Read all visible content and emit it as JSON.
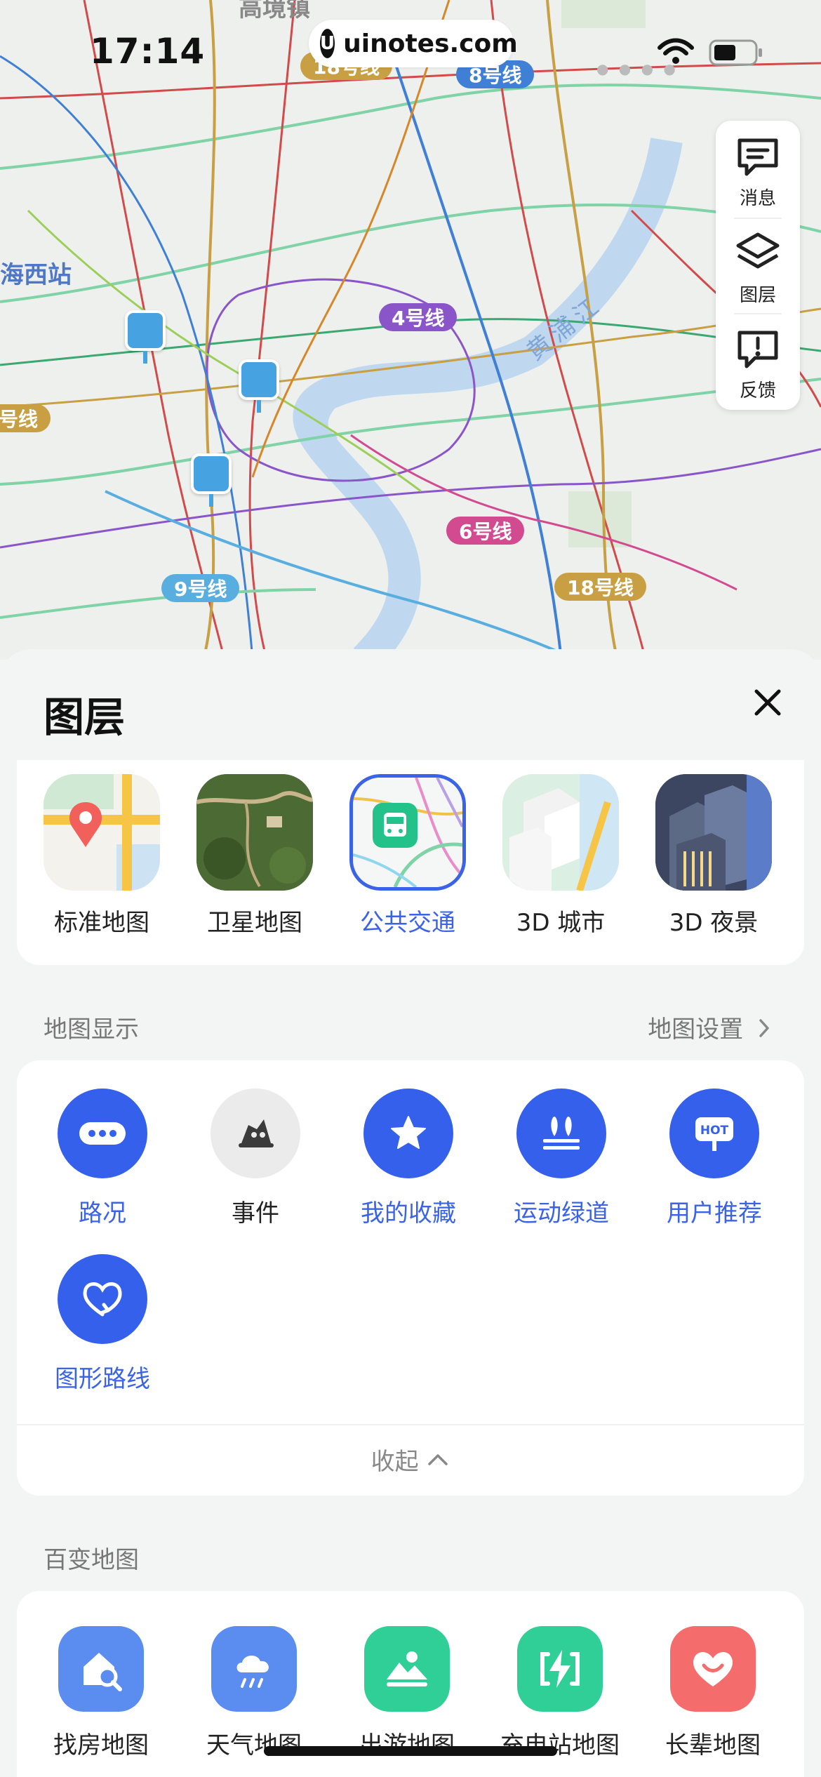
{
  "status_bar": {
    "time": "17:14",
    "url": "uinotes.com",
    "logo_letter": "U"
  },
  "map": {
    "place_labels": [
      "海西站",
      "高境镇"
    ],
    "line_labels": [
      {
        "text": "8号线",
        "color": "#3f7fd6"
      },
      {
        "text": "4号线",
        "color": "#8a55c9"
      },
      {
        "text": "6号线",
        "color": "#d24a8f"
      },
      {
        "text": "9号线",
        "color": "#59aee0"
      },
      {
        "text": "18号线",
        "color": "#c8a043"
      },
      {
        "text": "号线",
        "color": "#c8a043"
      },
      {
        "text": "18号线",
        "color": "#c8a043"
      }
    ],
    "river_label": "黄浦江"
  },
  "toolbar": {
    "items": [
      {
        "label": "消息",
        "icon": "message-icon"
      },
      {
        "label": "图层",
        "icon": "layers-icon"
      },
      {
        "label": "反馈",
        "icon": "feedback-icon"
      }
    ]
  },
  "sheet": {
    "title": "图层",
    "layers": [
      {
        "label": "标准地图",
        "icon": "standard-map-thumb"
      },
      {
        "label": "卫星地图",
        "icon": "satellite-map-thumb"
      },
      {
        "label": "公共交通",
        "icon": "transit-map-thumb",
        "selected": true
      },
      {
        "label": "3D 城市",
        "icon": "city-3d-thumb"
      },
      {
        "label": "3D 夜景",
        "icon": "night-3d-thumb"
      }
    ],
    "display_section": {
      "title": "地图显示",
      "settings_link": "地图设置",
      "features": [
        {
          "label": "路况",
          "icon": "traffic-icon",
          "active": true
        },
        {
          "label": "事件",
          "icon": "event-icon",
          "active": false
        },
        {
          "label": "我的收藏",
          "icon": "star-icon",
          "active": true
        },
        {
          "label": "运动绿道",
          "icon": "greenway-icon",
          "active": true
        },
        {
          "label": "用户推荐",
          "icon": "hot-icon",
          "active": true
        },
        {
          "label": "图形路线",
          "icon": "heart-route-icon",
          "active": true
        }
      ],
      "hot_text": "HOT",
      "collapse_label": "收起"
    },
    "variety_section": {
      "title": "百变地图",
      "items": [
        {
          "label": "找房地图",
          "icon": "house-search-icon",
          "color": "#5b8cf0"
        },
        {
          "label": "天气地图",
          "icon": "weather-icon",
          "color": "#5b8cf0"
        },
        {
          "label": "出游地图",
          "icon": "travel-icon",
          "color": "#2fcf97"
        },
        {
          "label": "充电站地图",
          "icon": "charging-icon",
          "color": "#2fcf97"
        },
        {
          "label": "长辈地图",
          "icon": "elder-heart-icon",
          "color": "#f46c6c"
        }
      ]
    }
  }
}
